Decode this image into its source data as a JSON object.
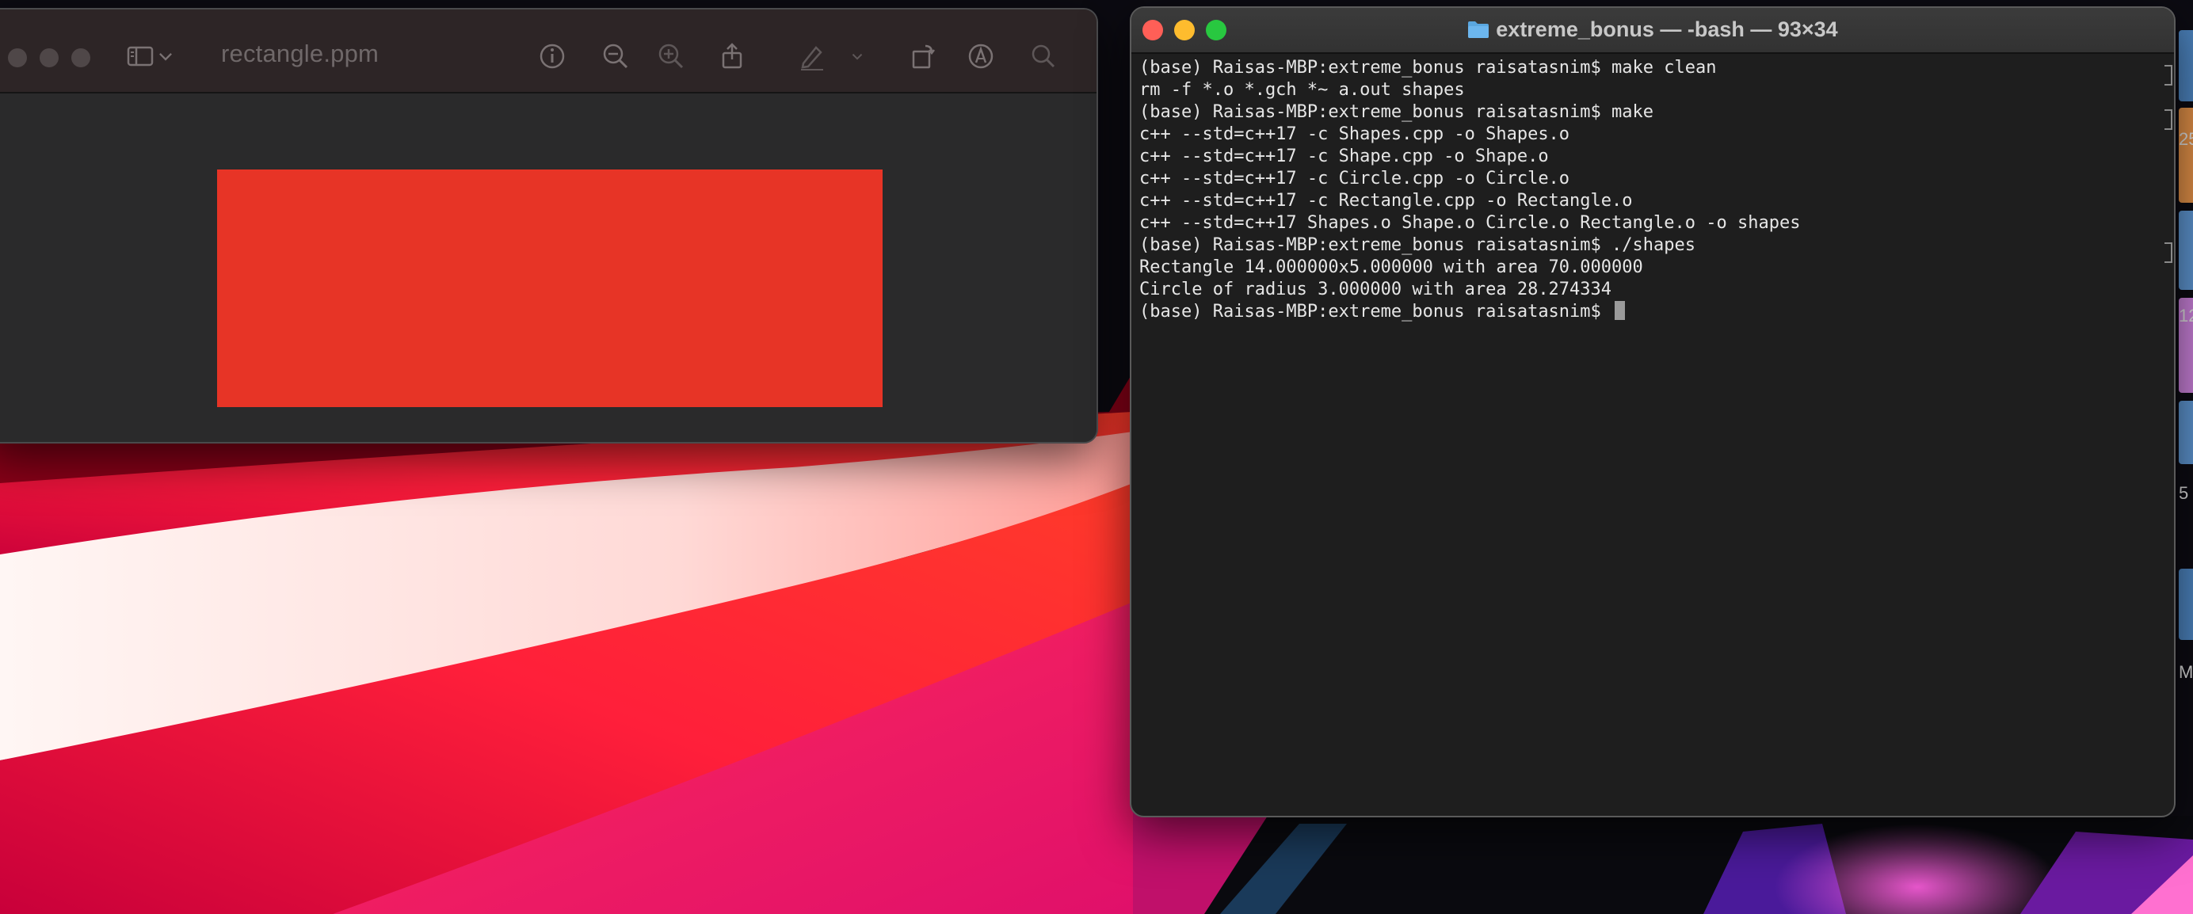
{
  "preview": {
    "title": "rectangle.ppm",
    "image_color": "#e73426",
    "toolbar_icons": [
      "sidebar-icon",
      "chevron-down-icon",
      "info-icon",
      "zoom-out-icon",
      "zoom-in-icon",
      "share-icon",
      "markup-pen-icon",
      "chevron-down-icon",
      "rotate-icon",
      "markup-icon",
      "search-icon"
    ]
  },
  "terminal": {
    "title": "extreme_bonus — -bash — 93×34",
    "lines": [
      {
        "text": "(base) Raisas-MBP:extreme_bonus raisatasnim$ make clean",
        "marked": true
      },
      {
        "text": "rm -f *.o *.gch *~ a.out shapes",
        "marked": false
      },
      {
        "text": "(base) Raisas-MBP:extreme_bonus raisatasnim$ make",
        "marked": true
      },
      {
        "text": "c++ --std=c++17 -c Shapes.cpp -o Shapes.o",
        "marked": false
      },
      {
        "text": "c++ --std=c++17 -c Shape.cpp -o Shape.o",
        "marked": false
      },
      {
        "text": "c++ --std=c++17 -c Circle.cpp -o Circle.o",
        "marked": false
      },
      {
        "text": "c++ --std=c++17 -c Rectangle.cpp -o Rectangle.o",
        "marked": false
      },
      {
        "text": "c++ --std=c++17 Shapes.o Shape.o Circle.o Rectangle.o -o shapes",
        "marked": false
      },
      {
        "text": "(base) Raisas-MBP:extreme_bonus raisatasnim$ ./shapes",
        "marked": true
      },
      {
        "text": "Rectangle 14.000000x5.000000 with area 70.000000",
        "marked": false
      },
      {
        "text": "Circle of radius 3.000000 with area 28.274334",
        "marked": false
      },
      {
        "text": "(base) Raisas-MBP:extreme_bonus raisatasnim$ ",
        "marked": false,
        "cursor": true
      }
    ]
  },
  "edge": {
    "chars": [
      "25",
      "12",
      "5",
      "M"
    ]
  }
}
